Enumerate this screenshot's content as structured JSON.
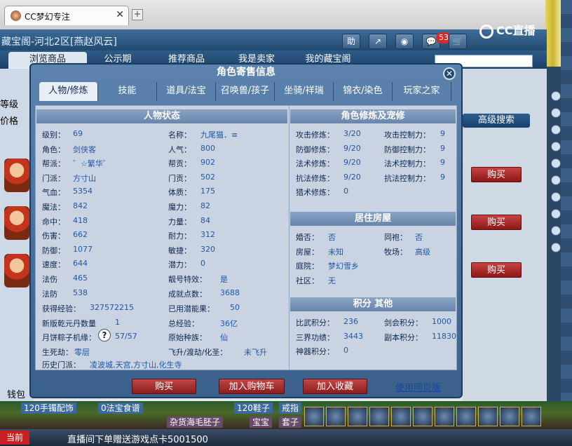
{
  "browser": {
    "tab_title": "CC梦幻专注",
    "close": "✕",
    "new_tab": "+",
    "logo": "CC直播"
  },
  "game": {
    "window_title": "藏宝阁-河北2区[燕赵风云]",
    "header_buttons": [
      "助",
      "↗",
      "◉",
      "💬",
      "🛒"
    ],
    "badge": "53",
    "nav": [
      "浏览商品",
      "公示期",
      "推荐商品",
      "我是卖家",
      "我的藏宝阁"
    ],
    "left_labels": [
      "等级",
      "价格"
    ],
    "adv_search": "高级搜索",
    "buy": "购买",
    "wallet": "钱包"
  },
  "modal": {
    "title": "角色寄售信息",
    "close": "✕",
    "tabs": [
      "人物/修炼",
      "技能",
      "道具/法宝",
      "召唤兽/孩子",
      "坐骑/祥瑞",
      "锦衣/染色",
      "玩家之家"
    ],
    "left_section": "人物状态",
    "status_left": [
      {
        "label": "级别：",
        "value": "69"
      },
      {
        "label": "角色：",
        "value": "剑侠客"
      },
      {
        "label": "帮派：",
        "value": "゛☆繁华゜"
      },
      {
        "label": "门派：",
        "value": "方寸山"
      },
      {
        "label": "气血：",
        "value": "5354"
      },
      {
        "label": "魔法：",
        "value": "842"
      },
      {
        "label": "命中：",
        "value": "418"
      },
      {
        "label": "伤害：",
        "value": "662"
      },
      {
        "label": "防御：",
        "value": "1077"
      },
      {
        "label": "速度：",
        "value": "644"
      },
      {
        "label": "法伤",
        "value": "465"
      },
      {
        "label": "法防",
        "value": "538"
      }
    ],
    "status_right": [
      {
        "label": "名称：",
        "value": "九尾猫．≡"
      },
      {
        "label": "人气：",
        "value": "800"
      },
      {
        "label": "帮贡：",
        "value": "902"
      },
      {
        "label": "门贡：",
        "value": "502"
      },
      {
        "label": "体质：",
        "value": "175"
      },
      {
        "label": "魔力：",
        "value": "82"
      },
      {
        "label": "力量：",
        "value": "84"
      },
      {
        "label": "耐力：",
        "value": "312"
      },
      {
        "label": "敏捷：",
        "value": "320"
      },
      {
        "label": "潜力：",
        "value": "0"
      },
      {
        "label": "靓号特效：",
        "value": "是"
      },
      {
        "label": "成就点数：",
        "value": "3688"
      }
    ],
    "extra_rows": [
      {
        "l1": "获得经验：",
        "v1": "327572215",
        "l2": "已用潜能果：",
        "v2": "50"
      },
      {
        "l1": "新版乾元丹数量",
        "v1": "1",
        "l2": "总经验：",
        "v2": "36亿"
      },
      {
        "l1": "月饼粽子机缘：",
        "v1": "57/57",
        "l2": "原始种族：",
        "v2": "仙"
      },
      {
        "l1": "生死劫：",
        "v1": "零层",
        "l2": "飞升/渡劫/化圣：",
        "v2": "未飞升"
      }
    ],
    "qmark": "?",
    "history_label": "历史门派：",
    "history_value": "凌波城,天宫,方寸山,化生寺",
    "cult_section": "角色修炼及宠修",
    "cultivation": [
      {
        "l1": "攻击修炼：",
        "v1": "3/20",
        "l2": "攻击控制力：",
        "v2": "9"
      },
      {
        "l1": "防御修炼：",
        "v1": "9/20",
        "l2": "防御控制力：",
        "v2": "9"
      },
      {
        "l1": "法术修炼：",
        "v1": "9/20",
        "l2": "法术控制力：",
        "v2": "9"
      },
      {
        "l1": "抗法修炼：",
        "v1": "9/20",
        "l2": "抗法控制力：",
        "v2": "9"
      },
      {
        "l1": "猎术修炼：",
        "v1": "0",
        "l2": "",
        "v2": ""
      }
    ],
    "house_section": "居住房屋",
    "house": [
      {
        "l1": "婚否：",
        "v1": "否",
        "l2": "同袍：",
        "v2": "否"
      },
      {
        "l1": "房屋：",
        "v1": "未知",
        "l2": "牧场：",
        "v2": "高级"
      },
      {
        "l1": "庭院：",
        "v1": "梦幻雪乡",
        "l2": "",
        "v2": ""
      },
      {
        "l1": "社区：",
        "v1": "无",
        "l2": "",
        "v2": ""
      }
    ],
    "points_section": "积分 其他",
    "points": [
      {
        "l1": "比武积分：",
        "v1": "236",
        "l2": "剑会积分：",
        "v2": "1000"
      },
      {
        "l1": "三界功绩：",
        "v1": "3443",
        "l2": "副本积分：",
        "v2": "11830"
      },
      {
        "l1": "神器积分：",
        "v1": "0",
        "l2": "",
        "v2": ""
      }
    ],
    "footer": {
      "buy": "购买",
      "add_cart": "加入购物车",
      "add_fav": "加入收藏",
      "web": "使用网页版"
    }
  },
  "bottom": {
    "tickers": [
      "120手镯配饰",
      "0法宝食谱",
      "120鞋子",
      "戒指",
      "鞋子",
      "杂货海毛胚子",
      "宝宝",
      "套子"
    ],
    "current": "当前",
    "stream_msg": "直播间下单赠送游戏点卡5001500"
  }
}
